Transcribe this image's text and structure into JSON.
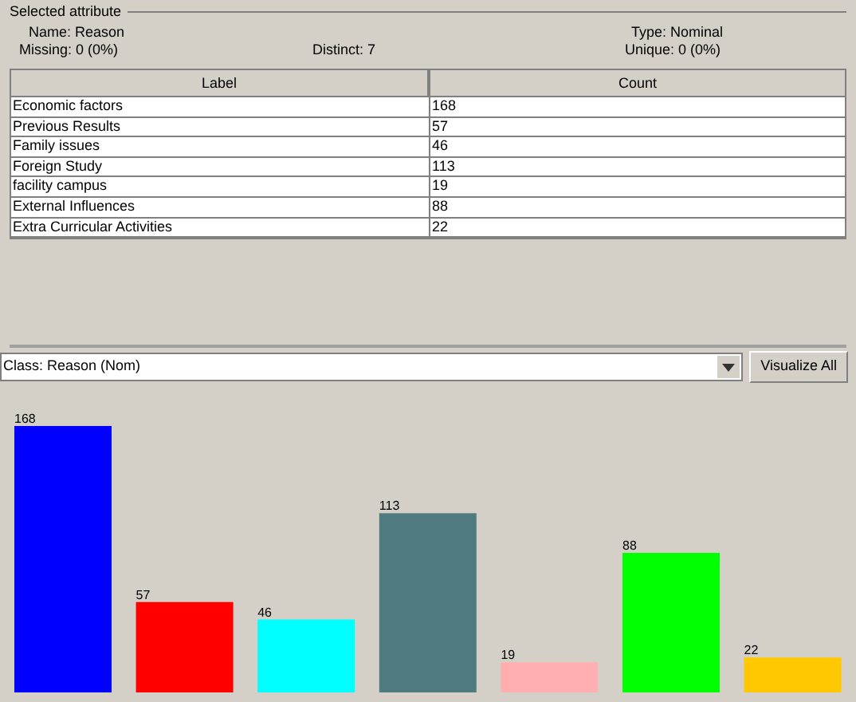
{
  "selected_attribute": {
    "title": "Selected attribute",
    "name": "Name: Reason",
    "missing": "Missing: 0 (0%)",
    "distinct": "Distinct: 7",
    "type": "Type: Nominal",
    "unique": "Unique: 0 (0%)"
  },
  "table": {
    "columns": [
      "Label",
      "Count"
    ],
    "rows": [
      [
        "Economic factors",
        "168"
      ],
      [
        "Previous Results",
        "57"
      ],
      [
        "Family issues",
        "46"
      ],
      [
        "Foreign Study",
        "113"
      ],
      [
        "facility campus",
        "19"
      ],
      [
        "External Influences",
        "88"
      ],
      [
        "Extra Curricular Activities",
        "22"
      ]
    ]
  },
  "class_selector": {
    "value": "Class: Reason (Nom)"
  },
  "visualize_button": "Visualize All",
  "chart_data": {
    "type": "bar",
    "values": [
      168,
      57,
      46,
      113,
      19,
      88,
      22
    ],
    "colors": [
      "#0000ff",
      "#ff0000",
      "#00ffff",
      "#4f7a80",
      "#ffafaf",
      "#00ff00",
      "#ffc800"
    ],
    "data_labels": true
  }
}
